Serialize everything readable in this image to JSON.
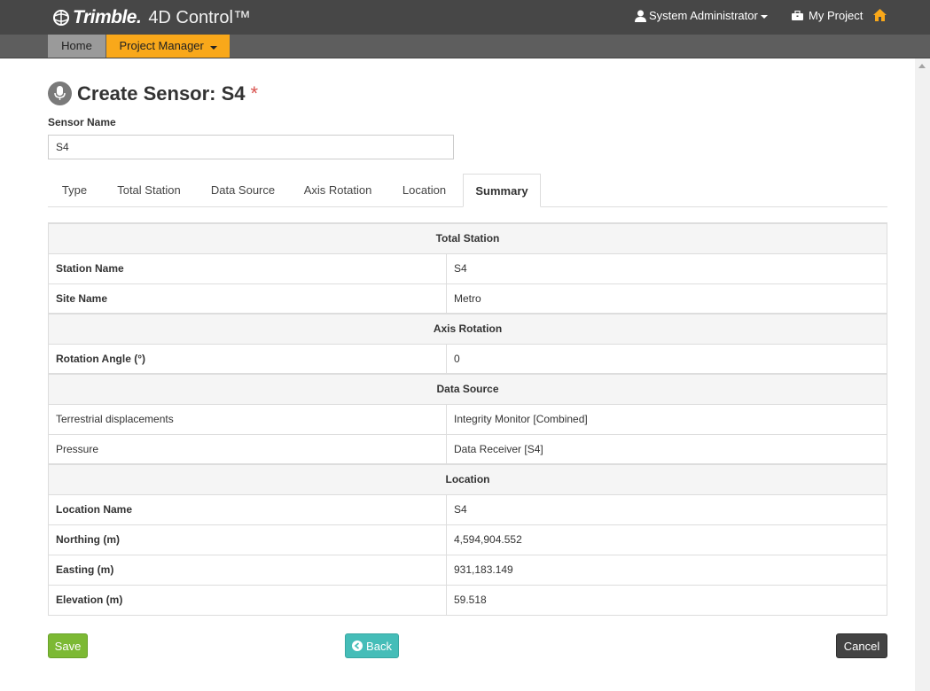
{
  "header": {
    "brand": "Trimble.",
    "product": "4D Control™",
    "user": "System Administrator",
    "project": "My Project"
  },
  "nav": {
    "home": "Home",
    "project_manager": "Project Manager"
  },
  "page": {
    "title": "Create Sensor: S4",
    "required_marker": "*",
    "sensor_name_label": "Sensor Name",
    "sensor_name_value": "S4"
  },
  "tabs": [
    "Type",
    "Total Station",
    "Data Source",
    "Axis Rotation",
    "Location",
    "Summary"
  ],
  "active_tab": "Summary",
  "summary": {
    "total_station": {
      "heading": "Total Station",
      "rows": [
        {
          "label": "Station Name",
          "value": "S4"
        },
        {
          "label": "Site Name",
          "value": "Metro"
        }
      ]
    },
    "axis_rotation": {
      "heading": "Axis Rotation",
      "rows": [
        {
          "label": "Rotation Angle (°)",
          "value": "0"
        }
      ]
    },
    "data_source": {
      "heading": "Data Source",
      "rows": [
        {
          "label": "Terrestrial displacements",
          "value": "Integrity Monitor [Combined]"
        },
        {
          "label": "Pressure",
          "value": "Data Receiver [S4]"
        }
      ]
    },
    "location": {
      "heading": "Location",
      "rows": [
        {
          "label": "Location Name",
          "value": "S4"
        },
        {
          "label": "Northing (m)",
          "value": "4,594,904.552"
        },
        {
          "label": "Easting (m)",
          "value": "931,183.149"
        },
        {
          "label": "Elevation (m)",
          "value": "59.518"
        }
      ]
    }
  },
  "buttons": {
    "save": "Save",
    "back": "Back",
    "cancel": "Cancel"
  },
  "icons": {
    "user": "user-icon",
    "project": "briefcase-icon",
    "home": "home-icon",
    "sensor": "sensor-icon",
    "back": "arrow-circle-left-icon"
  },
  "colors": {
    "topbar": "#474747",
    "navbar": "#5e5e5e",
    "accent": "#f9a81a",
    "save": "#7cb934",
    "back": "#45bdb8",
    "cancel": "#434343",
    "required": "#d9534f"
  }
}
